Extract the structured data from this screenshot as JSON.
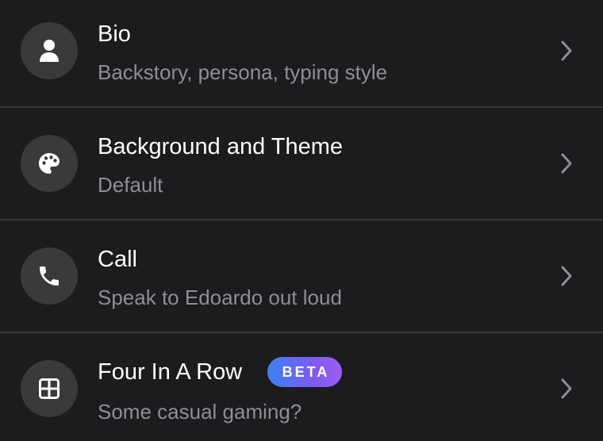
{
  "settings": {
    "items": [
      {
        "title": "Bio",
        "subtitle": "Backstory, persona, typing style",
        "icon": "person-icon"
      },
      {
        "title": "Background and Theme",
        "subtitle": "Default",
        "icon": "palette-icon"
      },
      {
        "title": "Call",
        "subtitle": "Speak to Edoardo out loud",
        "icon": "phone-icon"
      },
      {
        "title": "Four In A Row",
        "badge": "BETA",
        "subtitle": "Some casual gaming?",
        "icon": "grid-icon"
      }
    ]
  },
  "colors": {
    "background": "#1c1c1e",
    "icon_circle": "#3a3a3c",
    "title": "#ffffff",
    "subtitle": "#8e8e93",
    "divider": "#3a3a3c",
    "badge_gradient_start": "#3b82f6",
    "badge_gradient_end": "#9a5ef2"
  }
}
